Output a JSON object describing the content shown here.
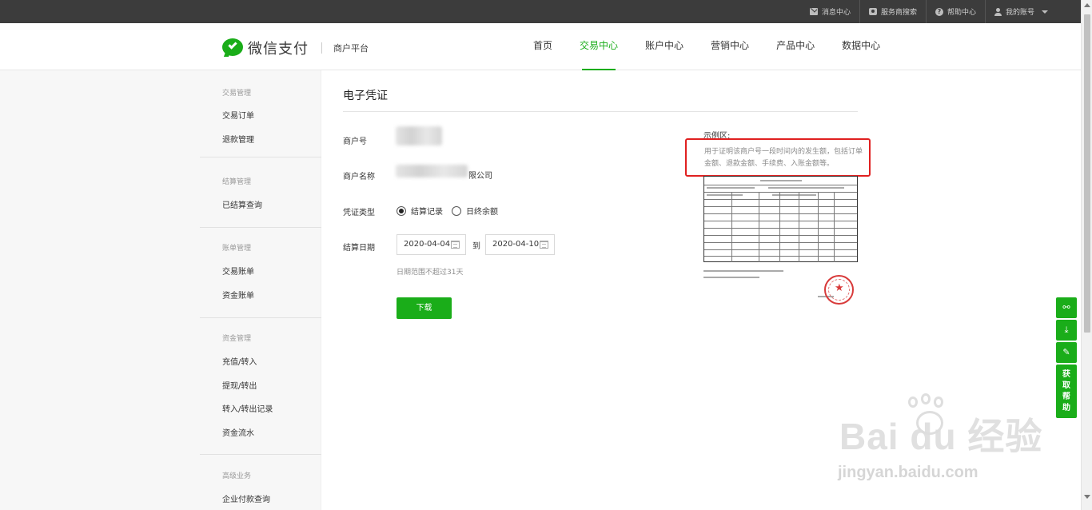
{
  "topbar": {
    "items": [
      {
        "label": "消息中心",
        "icon": "mail-icon"
      },
      {
        "label": "服务商搜索",
        "icon": "camera-icon"
      },
      {
        "label": "帮助中心",
        "icon": "help-icon"
      },
      {
        "label": "我的账号",
        "icon": "user-icon"
      }
    ]
  },
  "header": {
    "brand": "微信支付",
    "subtitle": "商户平台",
    "nav": [
      {
        "label": "首页",
        "active": false
      },
      {
        "label": "交易中心",
        "active": true
      },
      {
        "label": "账户中心",
        "active": false
      },
      {
        "label": "营销中心",
        "active": false
      },
      {
        "label": "产品中心",
        "active": false
      },
      {
        "label": "数据中心",
        "active": false
      }
    ]
  },
  "sidebar": {
    "groups": [
      {
        "title": "交易管理",
        "items": [
          "交易订单",
          "退款管理"
        ]
      },
      {
        "title": "结算管理",
        "items": [
          "已结算查询"
        ]
      },
      {
        "title": "账单管理",
        "items": [
          "交易账单",
          "资金账单"
        ]
      },
      {
        "title": "资金管理",
        "items": [
          "充值/转入",
          "提现/转出",
          "转入/转出记录",
          "资金流水"
        ]
      },
      {
        "title": "高级业务",
        "items": [
          "企业付款查询"
        ]
      }
    ]
  },
  "main": {
    "title": "电子凭证",
    "fields": {
      "merchant_no_label": "商户号",
      "merchant_name_label": "商户名称",
      "merchant_name_suffix": "限公司",
      "type_label": "凭证类型",
      "type_options": [
        "结算记录",
        "日终余额"
      ],
      "type_selected": "结算记录",
      "date_label": "结算日期",
      "date_start": "2020-04-04",
      "date_to": "到",
      "date_end": "2020-04-10",
      "date_hint": "日期范围不超过31天"
    },
    "download_button": "下载",
    "example": {
      "label": "示例区:",
      "description": "用于证明该商户号一段时间内的发生额，包括订单金额、退款金额、手续费、入账金额等。"
    }
  },
  "float_toolbar": {
    "buttons": [
      {
        "icon": "link-icon",
        "glyph": "⚯"
      },
      {
        "icon": "download-icon",
        "glyph": "⤓"
      },
      {
        "icon": "edit-icon",
        "glyph": "✎"
      }
    ],
    "help": [
      "获",
      "取",
      "帮",
      "助"
    ]
  },
  "watermark": {
    "brand": "Bai  du 经验",
    "url": "jingyan.baidu.com"
  },
  "colors": {
    "accent": "#1aad19",
    "topbar": "#3c3c3c",
    "highlight_border": "#e02020"
  }
}
